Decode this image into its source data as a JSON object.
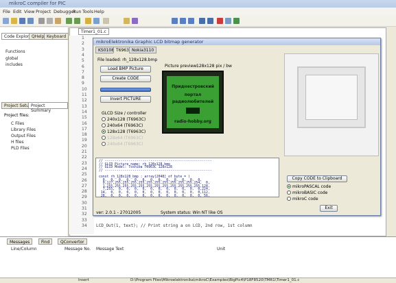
{
  "window": {
    "title": "mikroC compiler for PIC"
  },
  "menu": [
    "File",
    "Edit",
    "View",
    "Project",
    "Debugger",
    "Run",
    "Tools",
    "Help"
  ],
  "left_tabs": [
    "Code Explorer",
    "QHelp",
    "Keyboard"
  ],
  "explorer_tree": [
    "Functions",
    "global",
    "includes"
  ],
  "project_tabs": [
    "Project Setup",
    "Project Summary"
  ],
  "project_files_label": "Project files:",
  "project_tree": [
    "C Files",
    "Library Files",
    "Output Files",
    "H files",
    "PLD Files"
  ],
  "editor_tab": "Timer1_01.c",
  "line_numbers": [
    "1",
    "2",
    "3",
    "4",
    "5",
    "6",
    "7",
    "8",
    "9",
    "10",
    "11",
    "12",
    "13",
    "14",
    "15",
    "16",
    "17",
    "18",
    "19",
    "20",
    "21",
    "22",
    "23",
    "24",
    "25",
    "26",
    "27",
    "28",
    "29",
    "30",
    "31",
    "32",
    "33",
    "34"
  ],
  "editor_visible_code": "LCD_Out(1, text);    // Print string a on LCD, 2nd row, 1st column",
  "dialog": {
    "title": "mikroElektronika Graphic LCD bitmap generator",
    "tabs": [
      "KS0108",
      "T6963",
      "Nokia3110"
    ],
    "file_loaded": "File loaded: rh_128x128.bmp",
    "preview_label": "Picture preview:",
    "preview_size": "128x128 pix / bw",
    "buttons": {
      "load": "Load BMP Picture",
      "create": "Create CODE",
      "invert": "Invert PICTURE",
      "copy": "Copy CODE to Clipboard",
      "exit": "Exit"
    },
    "glcd_label": "GLCD Size / controller",
    "sizes": [
      {
        "label": "240x128 (T6963C)",
        "checked": false,
        "enabled": true
      },
      {
        "label": "240x64 (T6963C)",
        "checked": false,
        "enabled": true
      },
      {
        "label": "128x128 (T6963C)",
        "checked": true,
        "enabled": true
      },
      {
        "label": "128x64 (T6963C)",
        "checked": false,
        "enabled": false
      },
      {
        "label": "240x64 (T6963C)",
        "checked": false,
        "enabled": false
      }
    ],
    "lcd_text": [
      "Приднестровский",
      "портал",
      "радиолюбителей",
      "radio-hobby.org"
    ],
    "code_lines": [
      "// ------------------------------------------------------",
      "// GLCD Picture name: rh_128x128.bmp",
      "// GLCD Model: Toshiba T6963C 128x128",
      "// ------------------------------------------------------",
      "",
      "const rh_128x128_bmp : array[2048] of byte = (",
      "  0,  0,  0,  0,  0,  0,  0,  0,  0,  0,  0,  0,  0,",
      "  0,127,255,255,255,255,255,255,255,255,255,255,254,  0,",
      "  1,255,255,255,255,255,255,255,255,255,255,255,255,128,",
      "  7,255,  0,  0,  0,  0,  0,  0,  0,  0,  0,  0,  0,224,",
      " 14,  0,  0,  0,  0,  0,  0,  0,  0,  0,  0,  0,  0,112,",
      " 28,  0,  0,  0,  0,  0,  0,  0,  0,  0,  0,  0,  0, 56,"
    ],
    "lang_options": [
      {
        "label": "mikroPASCAL code",
        "checked": true
      },
      {
        "label": "mikroBASIC code",
        "checked": false
      },
      {
        "label": "mikroC code",
        "checked": false
      }
    ],
    "version": "ver: 2.0.1 - 27012005",
    "system_status": "System status: Win NT like OS"
  },
  "messages": {
    "tabs": [
      "Messages",
      "Find",
      "QConvertor"
    ],
    "columns": [
      "Line/Column",
      "Message No.",
      "Message Text",
      "Unit"
    ]
  },
  "statusbar": {
    "mode": "Insert",
    "path": "D:\\Program Files\\Mikroelektronika\\mikroC\\Examples\\BigPic4\\P18F8520\\TMR1\\Timer1_01.c"
  }
}
